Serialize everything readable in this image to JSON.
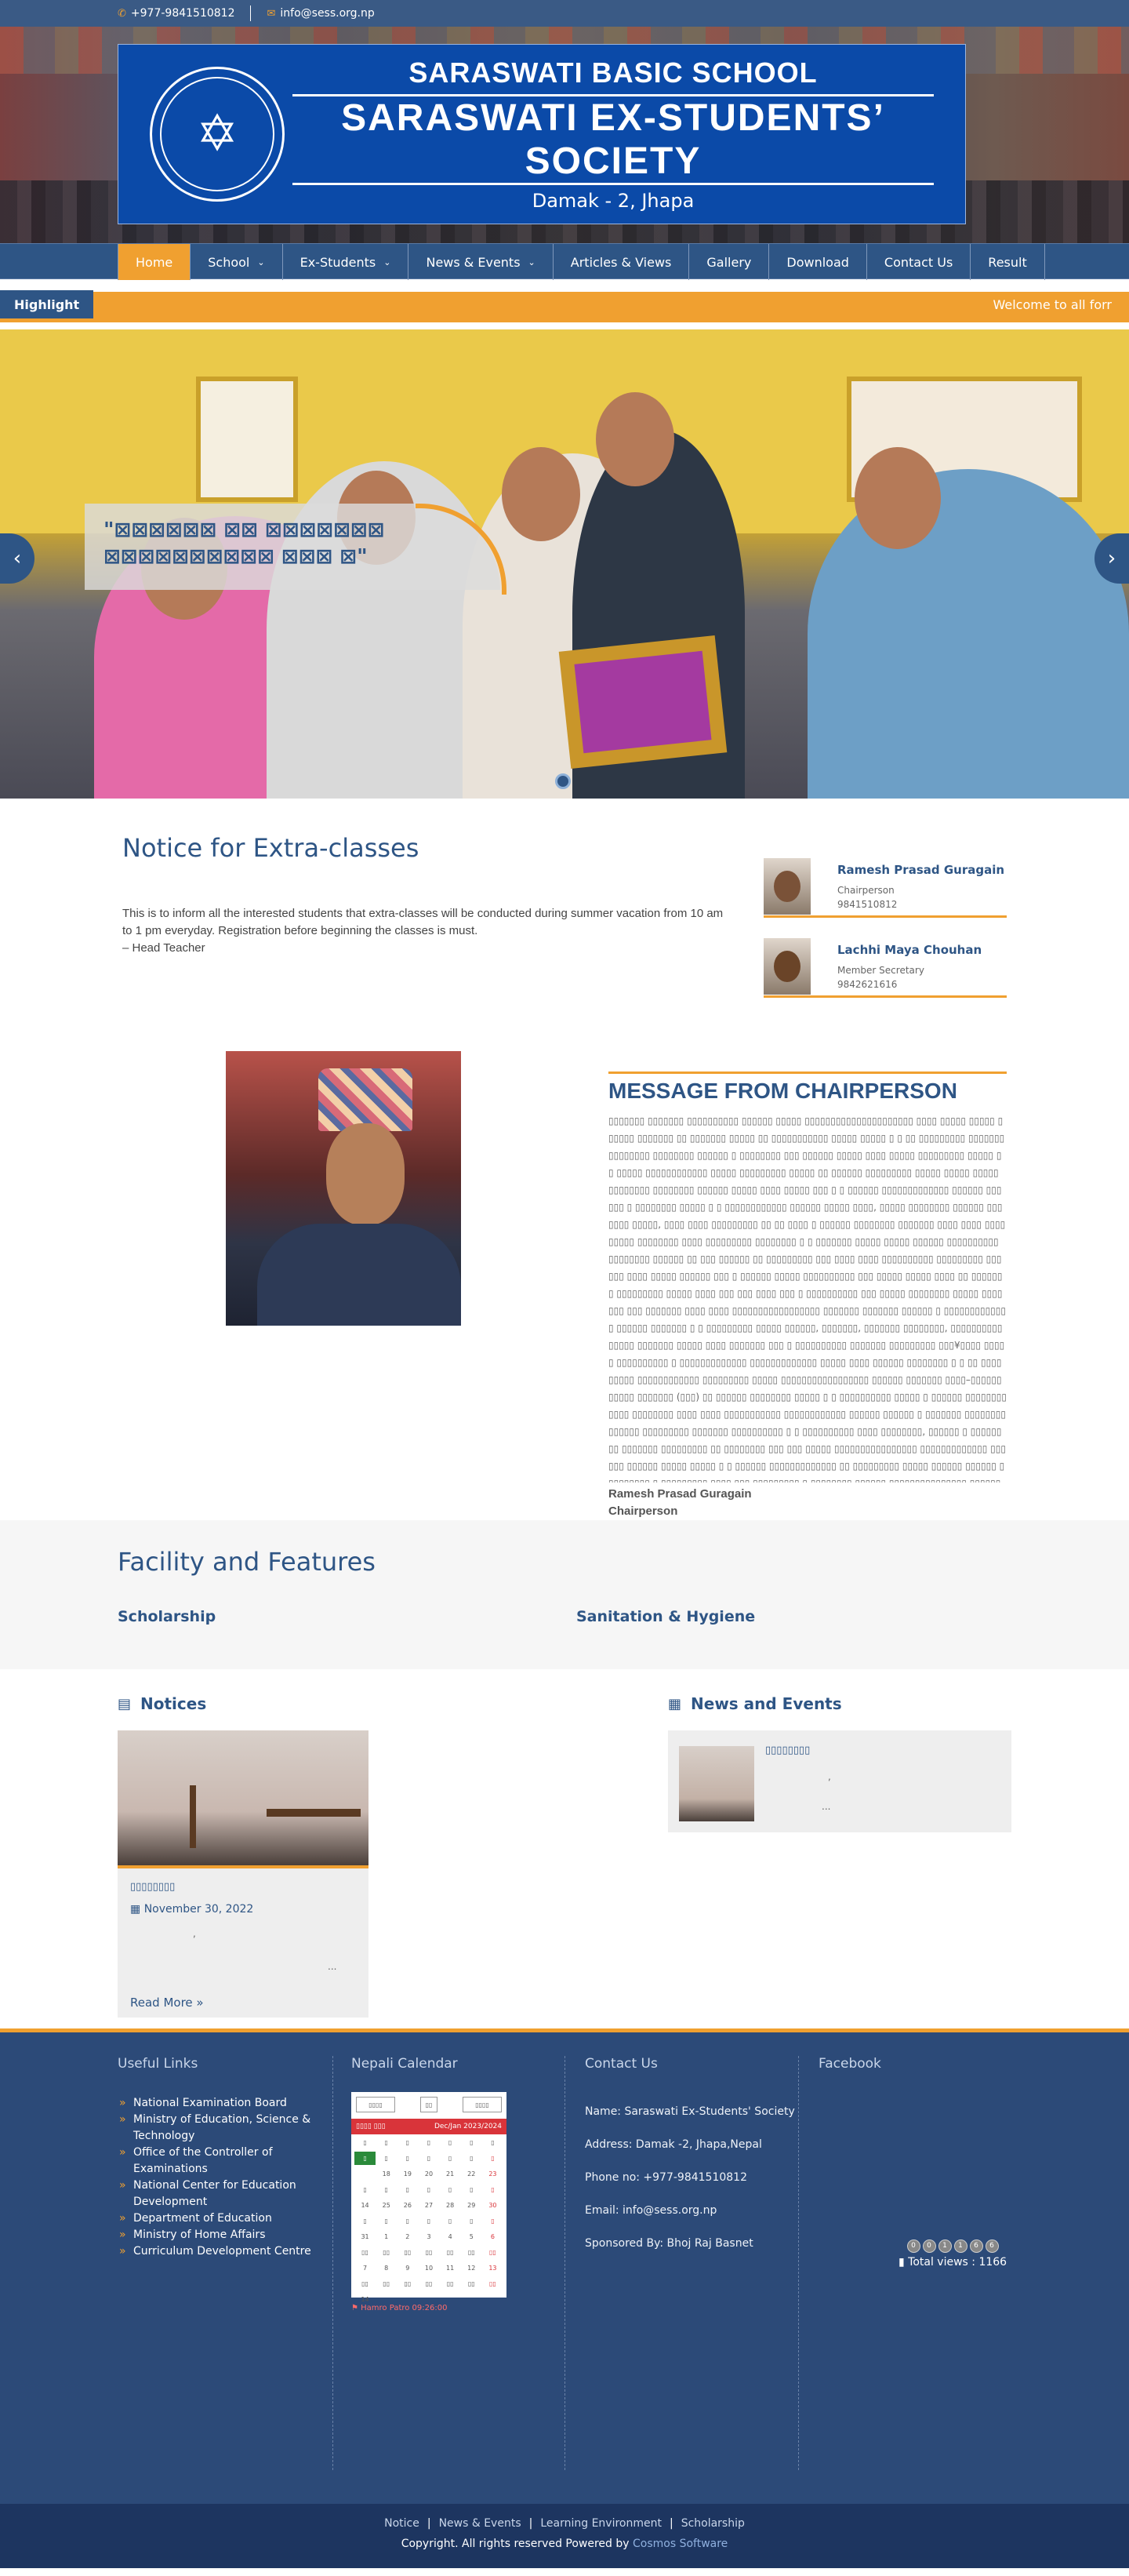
{
  "topbar": {
    "phone": "+977-9841510812",
    "email": "info@sess.org.np"
  },
  "header": {
    "line1": "SARASWATI BASIC SCHOOL",
    "line2": "SARASWATI EX-STUDENTS’ SOCIETY",
    "line3": "Damak - 2, Jhapa"
  },
  "nav": {
    "items": [
      {
        "label": "Home",
        "dropdown": false
      },
      {
        "label": "School",
        "dropdown": true
      },
      {
        "label": "Ex-Students",
        "dropdown": true
      },
      {
        "label": "News & Events",
        "dropdown": true
      },
      {
        "label": "Articles & Views",
        "dropdown": false
      },
      {
        "label": "Gallery",
        "dropdown": false
      },
      {
        "label": "Download",
        "dropdown": false
      },
      {
        "label": "Contact Us",
        "dropdown": false
      },
      {
        "label": "Result",
        "dropdown": false
      }
    ]
  },
  "highlight": {
    "label": "Highlight",
    "text": "Welcome to all forr"
  },
  "slider": {
    "caption": "\"⊠⊠⊠⊠⊠⊠ ⊠⊠ ⊠⊠⊠⊠⊠⊠⊠ ⊠⊠⊠⊠⊠⊠⊠⊠⊠⊠ ⊠⊠⊠ ⊠\""
  },
  "notice": {
    "title": "Notice for Extra-classes",
    "body": "This is to inform all the interested students that extra-classes will be conducted during summer vacation from 10 am to 1 pm everyday. Registration before beginning the classes is must.",
    "sign": "– Head Teacher"
  },
  "members": [
    {
      "name": "Ramesh Prasad Guragain",
      "role": "Chairperson",
      "phone": "9841510812"
    },
    {
      "name": "Lachhi Maya Chouhan",
      "role": "Member Secretary",
      "phone": "9842621616"
    }
  ],
  "message": {
    "title": "MESSAGE FROM CHAIRPERSON",
    "body": "▯▯▯▯▯▯▯ ▯▯▯▯▯▯▯ ▯▯▯▯▯▯▯▯▯▯ ▯▯▯▯▯▯ ▯▯▯▯▯ ▯▯▯▯▯▯▯▯▯▯▯▯▯▯▯▯▯▯▯▯▯ ▯▯▯▯ ▯▯▯▯▯ ▯▯▯▯▯ ▯▯▯▯▯▯ ▯▯▯▯▯▯▯ ▯▯ ▯▯▯▯▯▯▯ ▯▯▯▯▯ ▯▯ ▯▯▯▯▯▯▯▯▯▯▯ ▯▯▯▯▯ ▯▯▯▯▯ ▯ ▯ ▯▯ ▯▯▯▯▯▯▯▯▯ ▯▯▯▯▯▯▯ ▯▯▯▯▯▯▯▯ ▯▯▯▯▯▯▯▯ ▯▯▯▯▯▯ ▯ ▯▯▯▯▯▯▯▯ ▯▯▯ ▯▯▯▯▯▯ ▯▯▯▯▯ ▯▯▯▯ ▯▯▯▯▯ ▯▯▯▯▯▯▯▯▯ ▯▯▯▯▯ ▯ ▯ ▯▯▯▯▯ ▯▯▯▯▯▯▯▯▯▯▯▯ ▯▯▯▯▯ ▯▯▯▯▯▯▯▯▯ ▯▯▯▯▯ ▯▯ ▯▯▯▯▯▯ ▯▯▯▯▯▯▯▯▯ ▯▯▯▯▯ ▯▯▯▯▯ ▯▯▯▯▯ ▯▯▯▯▯▯▯▯ ▯▯▯▯▯▯▯▯ ▯▯▯▯▯▯ ▯▯▯▯▯ ▯▯▯▯ ▯▯▯▯▯ ▯▯▯ ▯ ▯ ▯▯▯▯▯▯ ▯▯▯▯▯▯▯▯▯▯▯▯▯ ▯▯▯▯▯▯ ▯▯▯▯▯▯ ▯ ▯▯▯▯▯▯▯▯ ▯▯▯▯▯ ▯ ▯ ▯▯▯▯▯▯▯▯▯▯▯▯ ▯▯▯▯▯▯ ▯▯▯▯▯ ▯▯▯▯, ▯▯▯▯▯ ▯▯▯▯▯▯▯▯ ▯▯▯▯▯▯ ▯▯▯▯▯▯▯ ▯▯▯▯▯, ▯▯▯▯ ▯▯▯▯ ▯▯▯▯▯▯▯▯▯ ▯▯ ▯▯ ▯▯▯▯ ▯ ▯▯▯▯▯▯ ▯▯▯▯▯▯▯▯ ▯▯▯▯▯▯▯ ▯▯▯▯ ▯▯▯▯ ▯▯▯▯ ▯▯▯▯▯ ▯▯▯▯▯▯▯▯ ▯▯▯▯ ▯▯▯▯▯▯▯▯▯ ▯▯▯▯▯▯▯▯ ▯ ▯ ▯▯▯▯▯▯▯ ▯▯▯▯▯ ▯▯▯▯▯ ▯▯▯▯▯▯ ▯▯▯▯▯▯▯▯▯▯ ▯▯▯▯▯▯▯▯ ▯▯▯▯▯▯ ▯▯ ▯▯▯ ▯▯▯▯▯▯ ▯▯ ▯▯▯▯▯▯▯▯▯ ▯▯▯ ▯▯▯▯ ▯▯▯▯ ▯▯▯▯▯▯▯▯▯▯ ▯▯▯▯▯▯▯▯▯ ▯▯▯▯▯▯ ▯▯▯▯ ▯▯▯▯▯ ▯▯▯▯▯▯ ▯▯▯ ▯ ▯▯▯▯▯▯ ▯▯▯▯▯ ▯▯▯▯▯▯▯▯▯▯ ▯▯▯ ▯▯▯▯▯ ▯▯▯▯▯ ▯▯▯▯ ▯▯ ▯▯▯▯▯▯▯ ▯▯▯▯▯▯▯▯▯ ▯▯▯▯▯ ▯▯▯▯ ▯▯▯ ▯▯▯ ▯▯▯▯ ▯▯▯ ▯ ▯▯▯▯▯▯▯▯▯▯ ▯▯▯ ▯▯▯▯▯ ▯▯▯▯▯▯▯▯ ▯▯▯▯▯ ▯▯▯▯▯▯▯ ▯▯▯ ▯▯▯▯▯▯▯ ▯▯▯▯ ▯▯▯▯ ▯▯▯▯▯▯▯▯▯▯▯▯▯▯▯▯▯ ▯▯▯▯▯▯▯ ▯▯▯▯▯▯▯ ▯▯▯▯▯▯ ▯ ▯▯▯▯▯▯▯▯▯▯▯▯▯ ▯▯▯▯▯▯ ▯▯▯▯▯▯▯ ▯ ▯ ▯▯▯▯▯▯▯▯▯ ▯▯▯▯▯ ▯▯▯▯▯▯, ▯▯▯▯▯▯▯, ▯▯▯▯▯▯▯ ▯▯▯▯▯▯▯▯, ▯▯▯▯▯▯▯▯▯▯▯▯▯▯▯ ▯▯▯▯▯▯▯ ▯▯▯▯▯ ▯▯▯▯ ▯▯▯▯▯▯▯ ▯▯▯ ▯ ▯▯▯▯▯▯▯▯▯▯ ▯▯▯▯▯▯▯ ▯▯▯▯▯▯▯▯▯ ▯▯▯¥▯▯▯▯ ▯▯▯▯▯ ▯▯▯▯▯▯▯▯▯▯ ▯ ▯▯▯▯▯▯▯▯▯▯▯▯▯ ▯▯▯▯▯▯▯▯▯▯▯▯▯ ▯▯▯▯▯ ▯▯▯▯ ▯▯▯▯▯▯ ▯▯▯▯▯▯▯▯ ▯ ▯ ▯▯ ▯▯▯▯▯▯▯▯▯ ▯▯▯▯▯▯▯▯▯▯▯▯ ▯▯▯▯▯▯▯▯▯ ▯▯▯▯▯ ▯▯▯▯▯▯▯▯▯▯▯▯▯▯▯▯▯ ▯▯▯▯▯▯ ▯▯▯▯▯▯▯ ▯▯▯▯–▯▯▯▯▯▯▯▯▯▯▯ ▯▯▯▯▯▯▯ (▯▯▯) ▯▯ ▯▯▯▯▯▯ ▯▯▯▯▯▯▯▯ ▯▯▯▯▯ ▯ ▯ ▯▯▯▯▯▯▯▯▯▯ ▯▯▯▯▯ ▯ ▯▯▯▯▯▯ ▯▯▯▯▯▯▯▯▯▯▯▯ ▯▯▯▯▯▯▯▯ ▯▯▯▯ ▯▯▯▯ ▯▯▯▯▯▯▯▯▯▯▯ ▯▯▯▯▯▯▯▯▯▯▯▯ ▯▯▯▯▯▯ ▯▯▯▯▯▯ ▯ ▯▯▯▯▯▯▯ ▯▯▯▯▯▯▯▯▯▯▯▯▯▯ ▯▯▯▯▯▯▯▯▯ ▯▯▯▯▯▯▯ ▯▯▯▯▯▯▯▯▯▯ ▯ ▯ ▯▯▯▯▯▯▯▯▯▯ ▯▯▯▯ ▯▯▯▯▯▯▯▯, ▯▯▯▯▯▯ ▯ ▯▯▯▯▯▯▯▯ ▯▯▯▯▯▯▯ ▯▯▯▯▯▯▯▯▯ ▯▯ ▯▯▯▯▯▯▯▯ ▯▯▯ ▯▯▯ ▯▯▯▯▯ ▯▯▯▯▯▯▯▯▯▯▯▯▯▯▯▯ ▯▯▯▯▯▯▯▯▯▯▯▯▯ ▯▯▯▯▯▯ ▯▯▯▯▯▯ ▯▯▯▯▯ ▯▯▯▯▯ ▯ ▯ ▯▯▯▯▯▯ ▯▯▯▯▯▯▯▯▯▯▯▯▯ ▯▯ ▯▯▯▯▯▯▯▯▯ ▯▯▯▯▯ ▯▯▯▯▯▯ ▯▯▯▯▯▯ ▯▯▯▯▯▯▯▯▯ ▯ ▯▯▯▯▯▯▯▯▯ ▯▯▯▯ ▯▯▯ ▯▯▯▯▯▯▯▯▯ ▯ ▯▯▯▯▯▯▯▯ ▯▯▯▯▯▯ ▯▯▯▯▯▯▯▯▯▯▯▯▯▯▯ ▯▯▯▯▯▯ ▯▯▯▯▯▯ ▯",
    "sign_name": "Ramesh Prasad Guragain",
    "sign_role": "Chairperson"
  },
  "facility": {
    "title": "Facility and Features",
    "items": [
      "Scholarship",
      "Sanitation & Hygiene"
    ]
  },
  "notices_block": {
    "title": "Notices",
    "card_title": "▯▯▯▯▯▯▯▯",
    "date": "November 30, 2022",
    "dots1": ",",
    "dots2": "...",
    "read_more": "Read More »"
  },
  "news_block": {
    "title": "News and Events",
    "card_title": "▯▯▯▯▯▯▯▯",
    "dots1": ",",
    "dots2": "..."
  },
  "footer": {
    "useful_links_title": "Useful Links",
    "links": [
      "National Examination Board",
      "Ministry of Education, Science & Technology",
      "Office of the Controller of Examinations",
      "National Center for Education Development",
      "Department of Education",
      "Ministry of Home Affairs",
      "Curriculum Development Centre"
    ],
    "calendar_title": "Nepali Calendar",
    "calendar": {
      "sel1": "▯▯▯▯",
      "sel_mid": "▯▯",
      "sel2": "▯▯▯▯",
      "bar_left": "▯▯▯▯ ▯▯▯",
      "bar_right": "Dec/Jan 2023/2024",
      "days": [
        "▯",
        "▯",
        "▯",
        "▯",
        "▯",
        "▯",
        "▯"
      ],
      "cells": [
        "▯",
        "▯",
        "▯",
        "▯",
        "▯",
        "▯",
        "▯",
        "",
        "18",
        "19",
        "20",
        "21",
        "22",
        "23",
        "▯",
        "▯",
        "▯",
        "▯",
        "▯",
        "▯",
        "▯",
        "14",
        "25",
        "26",
        "27",
        "28",
        "29",
        "30",
        "▯",
        "▯",
        "▯",
        "▯",
        "▯",
        "▯",
        "▯",
        "31",
        "1",
        "2",
        "3",
        "4",
        "5",
        "6",
        "▯▯",
        "▯▯",
        "▯▯",
        "▯▯",
        "▯▯",
        "▯▯",
        "▯▯",
        "7",
        "8",
        "9",
        "10",
        "11",
        "12",
        "13",
        "▯▯",
        "▯▯",
        "▯▯",
        "▯▯",
        "▯▯",
        "▯▯",
        "▯▯",
        "14",
        "",
        "",
        "",
        "",
        "",
        ""
      ],
      "footer": "Hamro Patro 09:26:00"
    },
    "contact_title": "Contact Us",
    "contact": [
      "Name: Saraswati Ex-Students' Society",
      "Address: Damak -2, Jhapa,Nepal",
      "Phone no: +977-9841510812",
      "Email: info@sess.org.np",
      "Sponsored By: Bhoj Raj Basnet"
    ],
    "facebook_title": "Facebook",
    "visitor_digits": [
      "0",
      "0",
      "1",
      "1",
      "6",
      "6"
    ],
    "total_views": "Total views : 1166"
  },
  "bottom": {
    "links": [
      "Notice",
      "News & Events",
      "Learning Environment",
      "Scholarship"
    ],
    "copyright": "Copyright. All rights reserved Powered by",
    "powered": "Cosmos Software"
  }
}
